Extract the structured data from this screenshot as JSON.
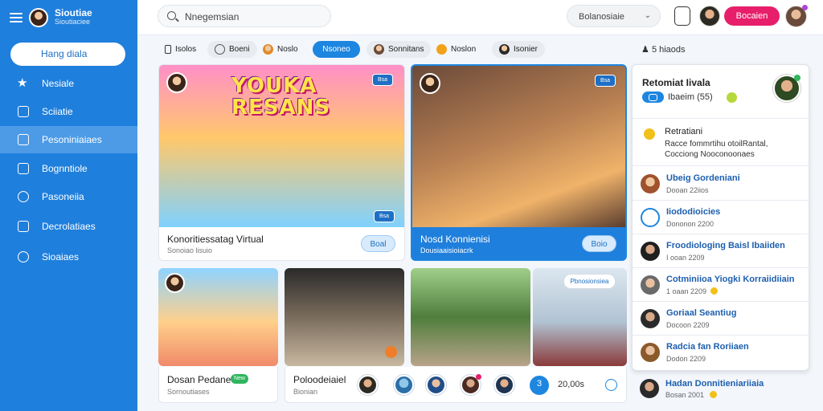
{
  "app": {
    "title": "Sioutiae",
    "subtitle": "Sioutiaciee"
  },
  "sidebar": {
    "search_placeholder": "Hang diala",
    "items": [
      {
        "label": "Nesiale",
        "icon": "star-icon"
      },
      {
        "label": "Sciiatie",
        "icon": "list-icon"
      },
      {
        "label": "Pesoniniaiaes",
        "icon": "box-icon",
        "active": true
      },
      {
        "label": "Bognntiole",
        "icon": "check-square-icon"
      },
      {
        "label": "Pasoneiia",
        "icon": "check-circle-icon"
      },
      {
        "label": "Decrolatiaes",
        "icon": "grid-icon"
      },
      {
        "label": "Sioaiaes",
        "icon": "sync-icon"
      }
    ]
  },
  "topbar": {
    "search_placeholder": "Nnegemsian",
    "select_value": "Bolanosiaie",
    "cta_label": "Bocaien"
  },
  "filters": [
    {
      "label": "Isolos",
      "style": "plain"
    },
    {
      "label": "Boeni",
      "style": "chip"
    },
    {
      "label": "Noslo",
      "style": "plain"
    },
    {
      "label": "Nsoneo",
      "style": "active"
    },
    {
      "label": "Sonnitans",
      "style": "chip"
    },
    {
      "label": "Noslon",
      "style": "plain"
    },
    {
      "label": "Isonier",
      "style": "chip"
    }
  ],
  "results_count": "5 hiaods",
  "cards": [
    {
      "headline_line1": "YOUKA",
      "headline_line2": "RESANS",
      "title": "Konoritiessatag Virtual",
      "subtitle": "Sonoiao lisuio",
      "button": "Boal",
      "badge_top": "Bsa",
      "badge_bottom": "Bsa"
    },
    {
      "title": "Nosd Konnienisi",
      "subtitle": "Dousiaaisioiacrk",
      "button": "Boio",
      "badge_top": "Bsa"
    }
  ],
  "thumbs": [
    {
      "title": "Dosan Pedane",
      "subtitle": "Sornoutiases",
      "badge": "New"
    },
    {
      "title": "Poloodeiaiel",
      "subtitle": "Bionian",
      "meta": "20,00s",
      "chat_label": "3"
    },
    {
      "label": "Pbnosionsiea"
    }
  ],
  "panel": {
    "title": "Retomiat Iivala",
    "meta": "Ibaeim (55)",
    "highlight": {
      "title": "Retratiani",
      "body": "Racce fommrtihu otoilRantal, Cocciong Nooconoonaes"
    },
    "items": [
      {
        "name": "Ubeig Gordeniani",
        "sub": "Dooan 22iios"
      },
      {
        "name": "Iiododioicies",
        "sub": "Dononon 2200"
      },
      {
        "name": "Froodiologing Baisl Ibaiiden",
        "sub": "I ooan 2209"
      },
      {
        "name": "Cotminiioa Yiogki Korraiidiiain",
        "sub": "1 oaan 2209"
      },
      {
        "name": "Goriaal Seantiug",
        "sub": "Docoon 2209"
      },
      {
        "name": "Radcia fan Roriiaen",
        "sub": "Dodon 2209"
      }
    ],
    "extra": {
      "name": "Hadan Donnitieniariiaia",
      "sub": "Bosan 2001"
    }
  }
}
